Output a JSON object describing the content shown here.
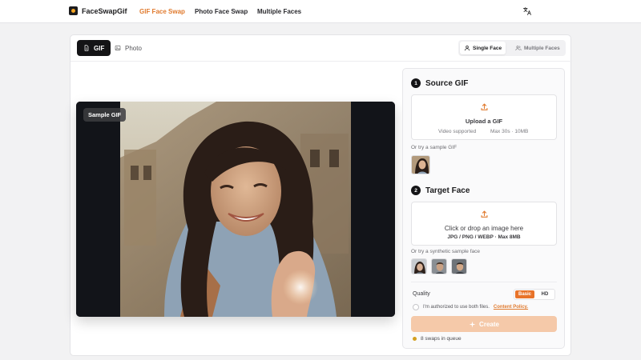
{
  "app": {
    "name": "FaceSwapGif"
  },
  "nav": {
    "links": [
      {
        "label": "GIF Face Swap",
        "active": true
      },
      {
        "label": "Photo Face Swap",
        "active": false
      },
      {
        "label": "Multiple Faces",
        "active": false
      }
    ]
  },
  "tabs": {
    "gif": "GIF",
    "photo": "Photo"
  },
  "modes": {
    "single": "Single Face",
    "multiple": "Multiple Faces"
  },
  "preview": {
    "badge": "Sample GIF"
  },
  "source": {
    "step": "1",
    "title": "Source GIF",
    "upload_title": "Upload a GIF",
    "video_supported": "Video supported",
    "limits": "Max 30s · 10MB",
    "sample_hint": "Or try a sample GIF"
  },
  "target": {
    "step": "2",
    "title": "Target Face",
    "upload_title": "Click or drop an image here",
    "formats": "JPG / PNG / WEBP · Max 8MB",
    "sample_hint": "Or try a synthetic sample face"
  },
  "quality": {
    "label": "Quality",
    "options": [
      "Basic",
      "HD"
    ],
    "selected": "Basic"
  },
  "consent": {
    "text": "I'm authorized to use both files.",
    "link": "Content Policy."
  },
  "create": {
    "label": "Create"
  },
  "queue": {
    "text": "8 swaps in queue"
  },
  "colors": {
    "accent": "#e07a2e",
    "quality_active": "#e8732a",
    "create_disabled": "#f5c9a9",
    "dark": "#141416"
  }
}
